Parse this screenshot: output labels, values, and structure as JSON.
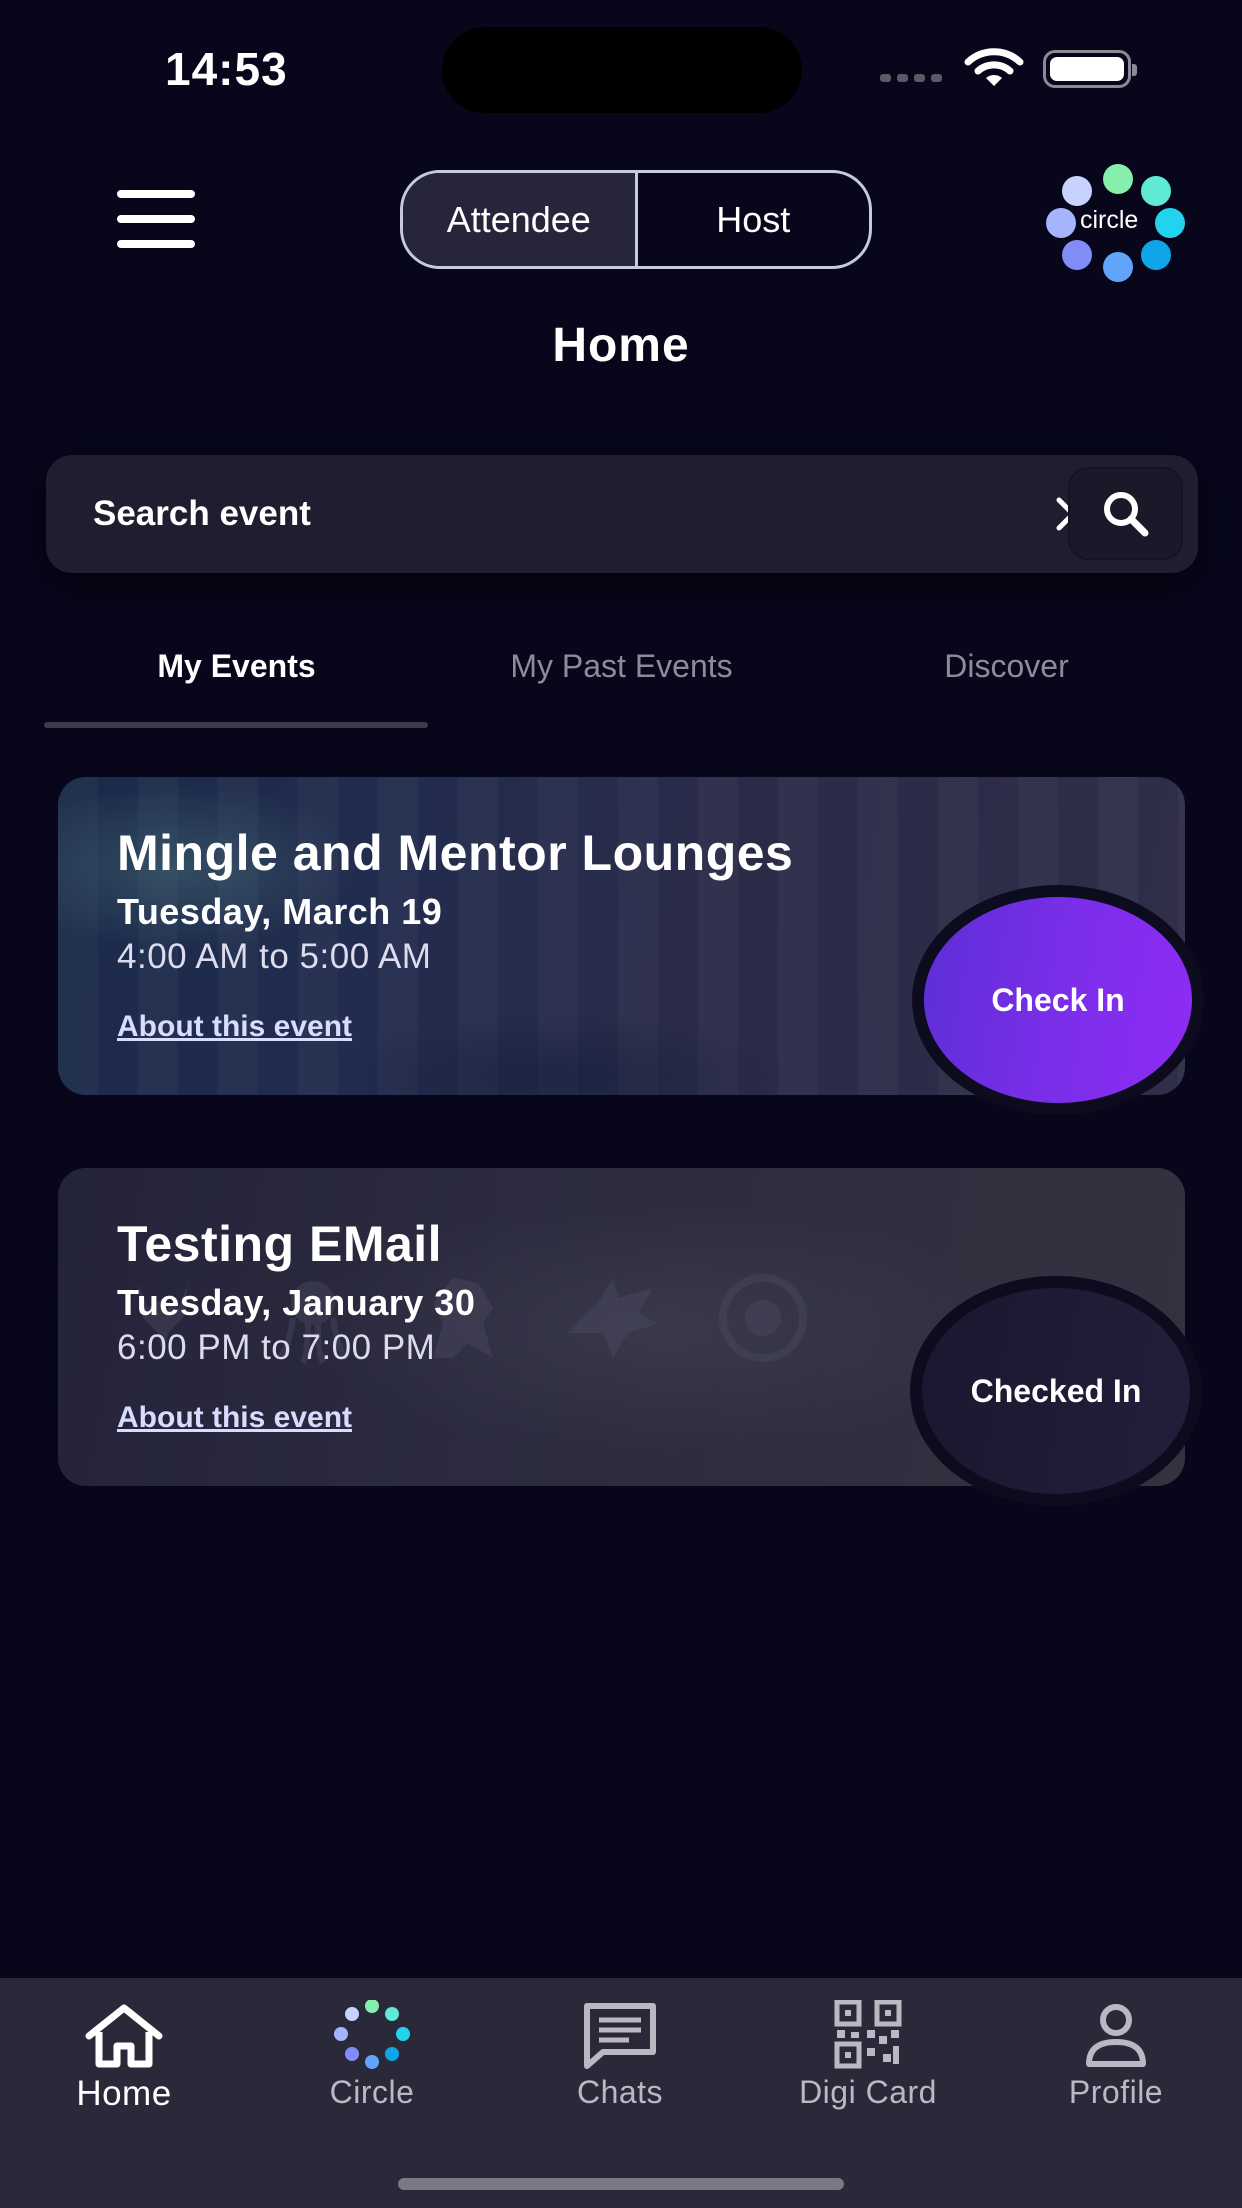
{
  "status_bar": {
    "time": "14:53"
  },
  "header": {
    "role_toggle": {
      "attendee_label": "Attendee",
      "host_label": "Host",
      "selected": "Attendee"
    },
    "logo_text": "circle",
    "page_title": "Home"
  },
  "search": {
    "placeholder": "Search event"
  },
  "tabs": [
    {
      "label": "My Events",
      "active": true
    },
    {
      "label": "My Past Events",
      "active": false
    },
    {
      "label": "Discover",
      "active": false
    }
  ],
  "events": [
    {
      "title": "Mingle and Mentor Lounges",
      "date": "Tuesday, March 19",
      "time": "4:00 AM to 5:00 AM",
      "about_label": "About this event",
      "action_label": "Check In"
    },
    {
      "title": "Testing EMail",
      "date": "Tuesday, January 30",
      "time": "6:00 PM to 7:00 PM",
      "about_label": "About this event",
      "action_label": "Checked In"
    }
  ],
  "bottom_nav": [
    {
      "label": "Home",
      "icon": "home-icon",
      "active": true
    },
    {
      "label": "Circle",
      "icon": "circle-logo-icon",
      "active": false
    },
    {
      "label": "Chats",
      "icon": "chat-icon",
      "active": false
    },
    {
      "label": "Digi Card",
      "icon": "qr-code-icon",
      "active": false
    },
    {
      "label": "Profile",
      "icon": "profile-icon",
      "active": false
    }
  ],
  "colors": {
    "background": "#07061a",
    "accent_purple": "#7a2ee8",
    "logo_dots": [
      "#c7d2fe",
      "#86efac",
      "#5eead4",
      "#22d3ee",
      "#0ea5e9",
      "#60a5fa",
      "#818cf8",
      "#a5b4fc"
    ]
  }
}
